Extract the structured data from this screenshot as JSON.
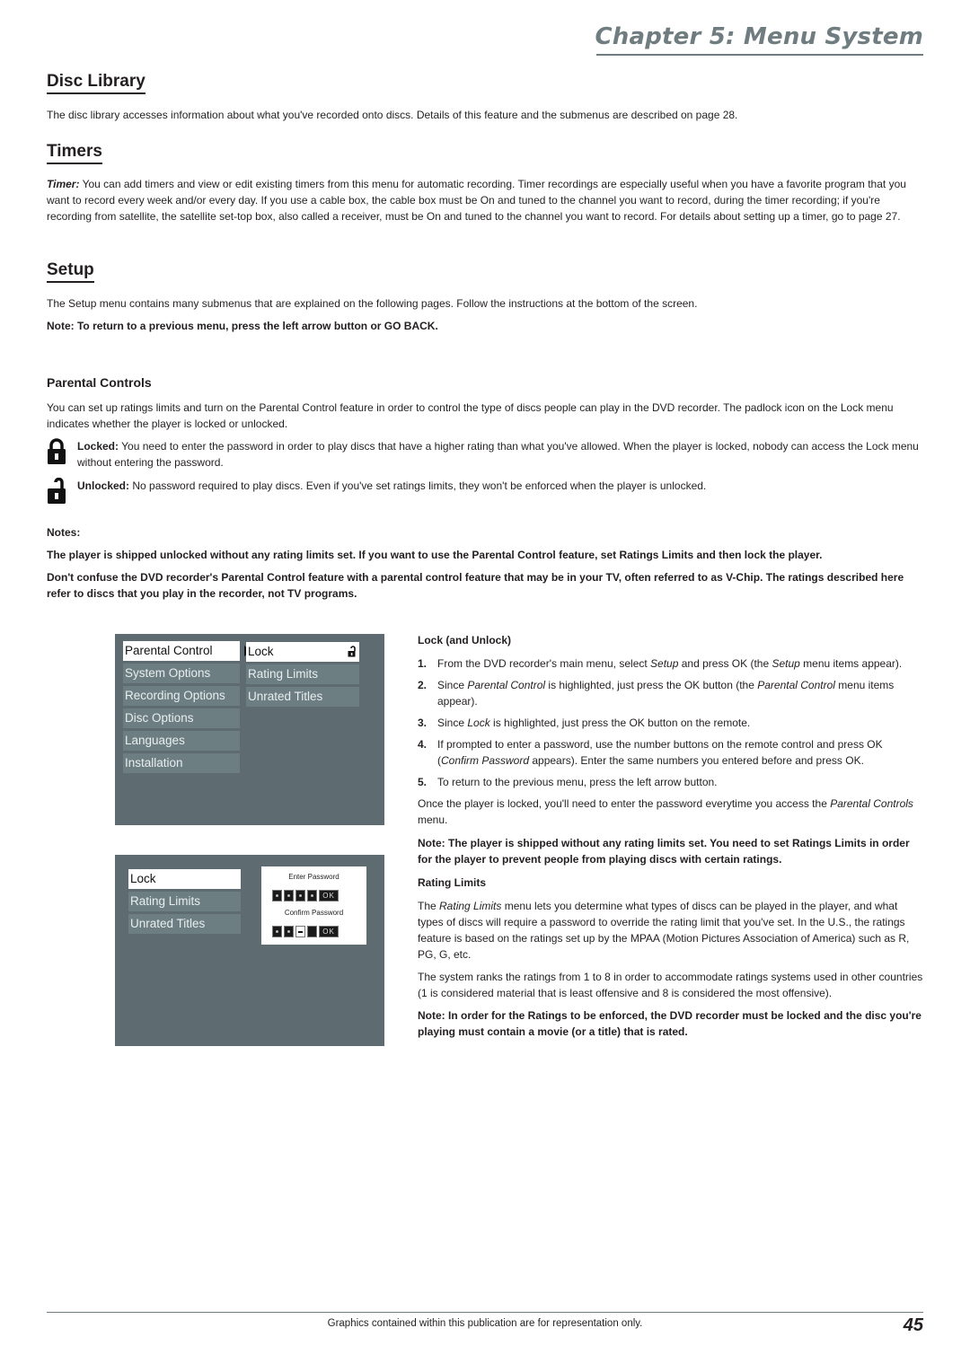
{
  "header": {
    "chapter_title": "Chapter 5: Menu System"
  },
  "disc_library": {
    "heading": "Disc Library",
    "body": "The disc library accesses information about what you've recorded onto discs. Details of this feature and the submenus are described on page 28."
  },
  "timers": {
    "heading": "Timers",
    "lead": "Timer:",
    "body": " You can add timers and view or edit existing timers from this menu for automatic recording. Timer recordings are especially useful when you have a favorite program that you want to record every week and/or every day. If you use a cable box, the cable box must be On and tuned to the channel you want to record, during the timer recording; if you're recording from satellite, the satellite set-top box, also called a receiver, must be On and tuned to the channel you want to record. For details about setting up a timer, go to page 27."
  },
  "setup": {
    "heading": "Setup",
    "body": "The Setup menu contains many submenus that are explained on the following pages. Follow the instructions at the bottom of the screen.",
    "note": "Note: To return to a previous menu, press the left arrow button or GO BACK."
  },
  "parental_controls": {
    "heading": "Parental Controls",
    "intro": "You can set up ratings limits and turn on the Parental Control feature in order to control the type of discs people can play in the DVD recorder. The padlock icon on the Lock menu indicates whether the player is locked or unlocked.",
    "locked_label": "Locked:",
    "locked_text": " You need to enter the password in order to play discs that have a higher rating than what you've allowed. When the player is locked, nobody can access the Lock menu without entering the password.",
    "unlocked_label": "Unlocked:",
    "unlocked_text": " No password required to play discs. Even if you've set ratings limits, they won't be enforced when the player is unlocked.",
    "notes_heading": "Notes:",
    "notes": [
      "The player is shipped unlocked without any rating limits set. If you want to use the Parental Control feature, set Ratings Limits and then lock the player.",
      "Don't confuse the DVD recorder's Parental Control feature with a parental control feature that may be in your TV, often referred to as V-Chip. The ratings described here refer to discs that you play in the recorder, not TV programs."
    ]
  },
  "screen1": {
    "left_menu": [
      "Parental Control",
      "System Options",
      "Recording Options",
      "Disc Options",
      "Languages",
      "Installation"
    ],
    "selected_left": "Parental Control",
    "right_menu": [
      "Lock",
      "Rating Limits",
      "Unrated Titles"
    ],
    "selected_right": "Lock"
  },
  "screen2": {
    "menu": [
      "Lock",
      "Rating Limits",
      "Unrated Titles"
    ],
    "selected": "Lock",
    "enter_password_label": "Enter Password",
    "confirm_password_label": "Confirm Password",
    "ok_label": "OK",
    "enter_password_filled": 4,
    "confirm_password_filled": 2
  },
  "lock_unlock": {
    "heading": "Lock (and Unlock)",
    "steps": [
      {
        "num": "1.",
        "html": "From the DVD recorder's main menu, select <i>Setup</i> and press OK (the <i>Setup</i> menu items appear)."
      },
      {
        "num": "2.",
        "html": "Since <i>Parental Control</i> is highlighted, just press the OK button (the <i>Parental Control</i> menu items appear)."
      },
      {
        "num": "3.",
        "html": "Since <i>Lock</i> is highlighted, just press the OK button on the remote."
      },
      {
        "num": "4.",
        "html": "If prompted to enter a password, use the number buttons on the remote control and press OK (<i>Confirm Password</i> appears). Enter the same numbers you entered before and press OK."
      },
      {
        "num": "5.",
        "html": "To return to the previous menu, press the left arrow button."
      }
    ],
    "after_html": "Once the player is locked, you'll need to enter the password everytime you access the <i>Parental Controls</i> menu.",
    "note": "Note: The player is shipped without any rating limits set. You need to set Ratings Limits in order for the player to prevent people from playing discs with certain ratings."
  },
  "rating_limits": {
    "heading": "Rating Limits",
    "para1_html": "The <i>Rating Limits</i> menu lets you determine what types of discs can be played in the player, and what types of discs will require a password to override the rating limit that you've set. In the U.S., the ratings feature is based on the ratings set up by the MPAA (Motion Pictures Association of America) such as R, PG, G, etc.",
    "para2": "The system ranks the ratings from 1 to 8 in order to accommodate ratings systems used in other countries (1 is considered material that is least offensive and 8 is considered the most offensive).",
    "note": "Note: In order for the Ratings to be enforced, the DVD recorder must be locked and the disc you're playing must contain a movie (or a title) that is rated."
  },
  "footer": {
    "text": "Graphics contained within this publication are for representation only.",
    "page_number": "45"
  }
}
